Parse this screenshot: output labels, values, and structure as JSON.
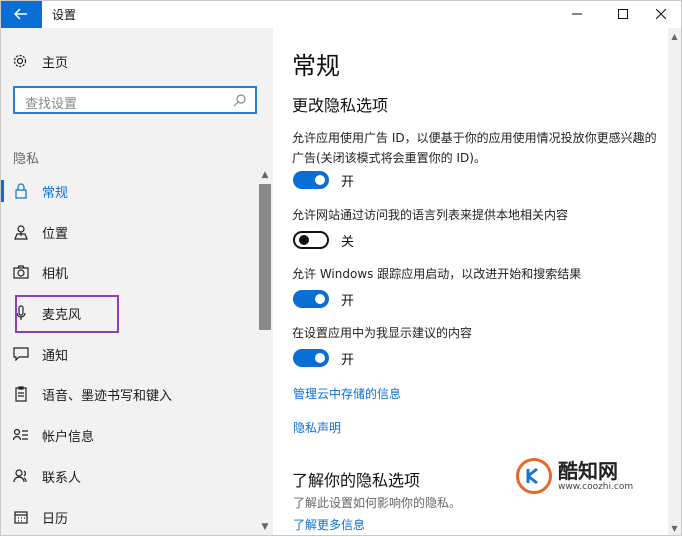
{
  "window": {
    "title": "设置",
    "controls": [
      "minimize-icon",
      "maximize-icon",
      "close-icon"
    ]
  },
  "sidebar": {
    "home_label": "主页",
    "search_placeholder": "查找设置",
    "section_label": "隐私",
    "items": [
      {
        "label": "常规",
        "icon": "lock-icon",
        "active": true
      },
      {
        "label": "位置",
        "icon": "location-icon",
        "active": false
      },
      {
        "label": "相机",
        "icon": "camera-icon",
        "active": false
      },
      {
        "label": "麦克风",
        "icon": "microphone-icon",
        "active": false
      },
      {
        "label": "通知",
        "icon": "notification-icon",
        "active": false
      },
      {
        "label": "语音、墨迹书写和键入",
        "icon": "clipboard-icon",
        "active": false
      },
      {
        "label": "帐户信息",
        "icon": "account-info-icon",
        "active": false
      },
      {
        "label": "联系人",
        "icon": "contacts-icon",
        "active": false
      },
      {
        "label": "日历",
        "icon": "calendar-icon",
        "active": false
      }
    ]
  },
  "main": {
    "title": "常规",
    "subtitle": "更改隐私选项",
    "settings": [
      {
        "text": "允许应用使用广告 ID，以便基于你的应用使用情况投放你更感兴趣的广告(关闭该模式将会重置你的 ID)。",
        "state": "开",
        "on": true
      },
      {
        "text": "允许网站通过访问我的语言列表来提供本地相关内容",
        "state": "关",
        "on": false
      },
      {
        "text": "允许 Windows 跟踪应用启动，以改进开始和搜索结果",
        "state": "开",
        "on": true
      },
      {
        "text": "在设置应用中为我显示建议的内容",
        "state": "开",
        "on": true
      }
    ],
    "link_cloud": "管理云中存储的信息",
    "link_privacy": "隐私声明",
    "learn_title": "了解你的隐私选项",
    "learn_desc": "了解此设置如何影响你的隐私。",
    "learn_link": "了解更多信息"
  },
  "watermark": {
    "name": "酷知网",
    "url": "www.coozhi.com"
  },
  "colors": {
    "accent": "#0a6fd4",
    "highlight_box": "#8b3fb8",
    "sidebar_bg": "#f2f2f2"
  }
}
